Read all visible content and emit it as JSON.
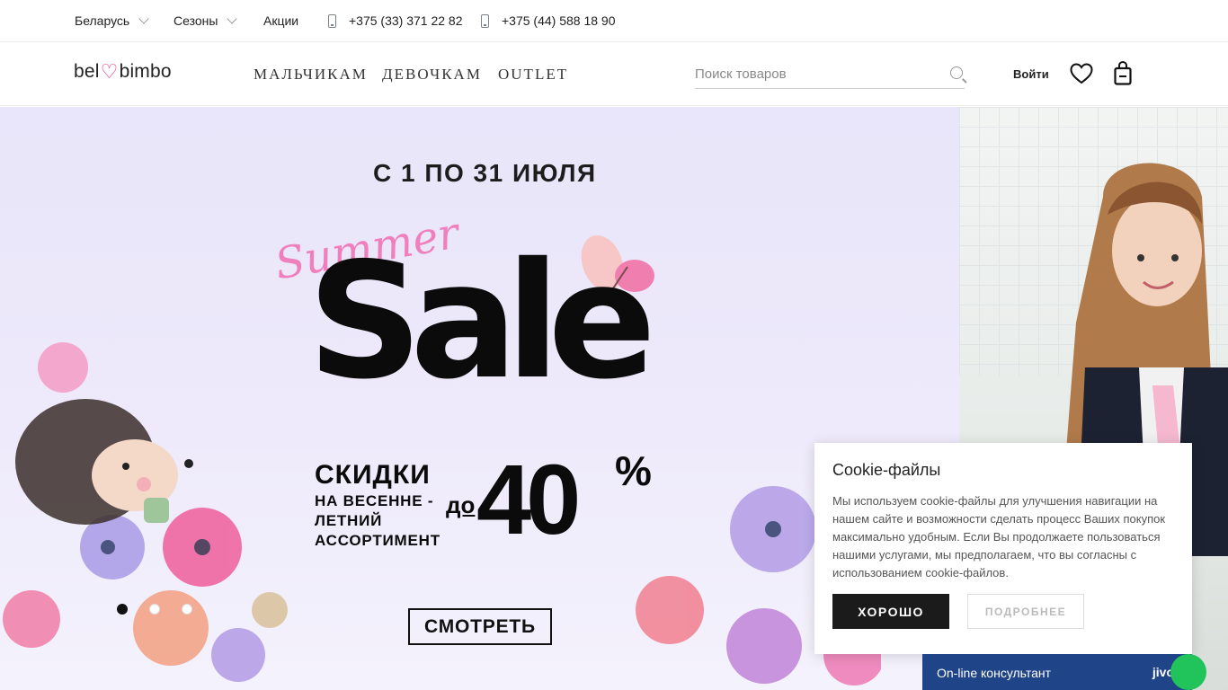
{
  "topbar": {
    "region": "Беларусь",
    "seasons": "Сезоны",
    "promo": "Акции",
    "phone1": "+375 (33) 371 22 82",
    "phone2": "+375 (44) 588 18 90"
  },
  "header": {
    "logo_left": "bel",
    "logo_right": "bimbo",
    "nav": [
      "МАЛЬЧИКАМ",
      "ДЕВОЧКАМ",
      "OUTLET"
    ],
    "search_placeholder": "Поиск товаров",
    "login": "Войти"
  },
  "banner": {
    "date": "С 1 ПО 31 ИЮЛЯ",
    "summer": "Summer",
    "sale": "Sale",
    "discount_title": "СКИДКИ",
    "discount_line1": "НА ВЕСЕННЕ -",
    "discount_line2": "ЛЕТНИЙ",
    "discount_line3": "АССОРТИМЕНТ",
    "up_to": "до",
    "percent": "40",
    "percent_sign": "%",
    "cta": "СМОТРЕТЬ"
  },
  "cookie": {
    "title": "Cookie-файлы",
    "text": "Мы используем cookie-файлы для улучшения навигации на нашем сайте и возможности сделать процесс Ваших покупок максимально удобным. Если Вы продолжаете пользоваться нашими услугами, мы предполагаем, что вы согласны с использованием cookie-файлов.",
    "ok": "ХОРОШО",
    "more": "ПОДРОБНЕЕ"
  },
  "chat": {
    "label": "On-line консультант",
    "brand": "jivo"
  },
  "colors": {
    "brand_pink": "#e9307b",
    "banner_bg": "#ece8fb",
    "chat_blue": "#1f4487"
  }
}
